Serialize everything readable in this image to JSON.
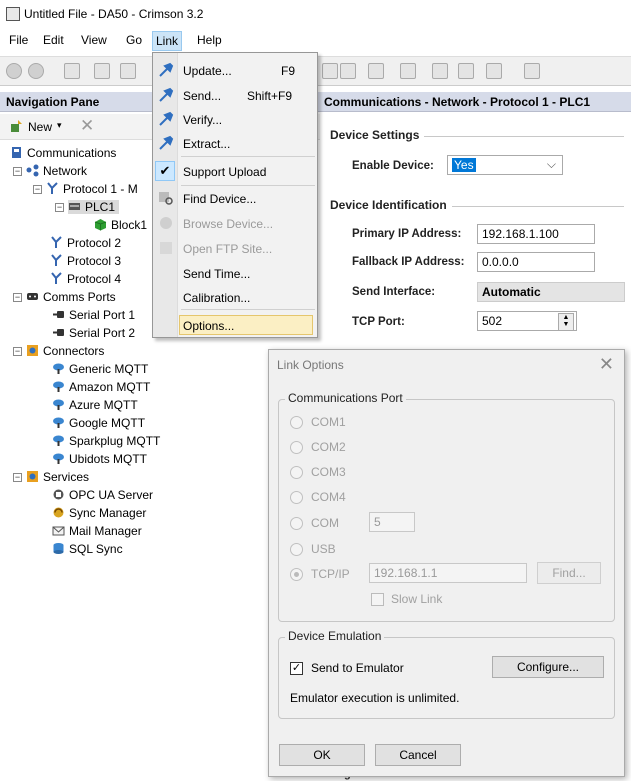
{
  "window": {
    "title": "Untitled File - DA50 - Crimson 3.2"
  },
  "menubar": {
    "items": [
      "File",
      "Edit",
      "View",
      "Go",
      "Link",
      "Help"
    ],
    "active": "Link"
  },
  "nav": {
    "title": "Navigation Pane",
    "new_label": "New",
    "tree": {
      "communications": "Communications",
      "network": "Network",
      "protocol1": "Protocol 1 - M",
      "plc1": "PLC1",
      "block1": "Block1",
      "protocol2": "Protocol 2",
      "protocol3": "Protocol 3",
      "protocol4": "Protocol 4",
      "comms_ports": "Comms Ports",
      "serial1": "Serial Port 1",
      "serial2": "Serial Port 2",
      "connectors": "Connectors",
      "generic": "Generic MQTT",
      "amazon": "Amazon MQTT",
      "azure": "Azure MQTT",
      "google": "Google MQTT",
      "sparkplug": "Sparkplug MQTT",
      "ubidots": "Ubidots MQTT",
      "services": "Services",
      "opcua": "OPC UA Server",
      "sync": "Sync Manager",
      "mail": "Mail Manager",
      "sql": "SQL Sync"
    }
  },
  "panel": {
    "title": "Communications - Network - Protocol 1 - PLC1",
    "device_settings": "Device Settings",
    "enable_label": "Enable Device:",
    "enable_value": "Yes",
    "device_identification": "Device Identification",
    "primary_ip_label": "Primary IP Address:",
    "primary_ip": "192.168.1.100",
    "fallback_ip_label": "Fallback IP Address:",
    "fallback_ip": "0.0.0.0",
    "send_iface_label": "Send Interface:",
    "send_iface": "Automatic",
    "tcp_port_label": "TCP Port:",
    "tcp_port": "502",
    "footer_text": "Register Writes"
  },
  "link_menu": {
    "update": "Update...",
    "update_sc": "F9",
    "send": "Send...",
    "send_sc": "Shift+F9",
    "verify": "Verify...",
    "extract": "Extract...",
    "support_upload": "Support Upload",
    "find_device": "Find Device...",
    "browse_device": "Browse Device...",
    "open_ftp": "Open FTP Site...",
    "send_time": "Send Time...",
    "calibration": "Calibration...",
    "options": "Options..."
  },
  "dialog": {
    "title": "Link Options",
    "close": "✕",
    "comm_port_group": "Communications Port",
    "com1": "COM1",
    "com2": "COM2",
    "com3": "COM3",
    "com4": "COM4",
    "com": "COM",
    "com_value": "5",
    "usb": "USB",
    "tcpip": "TCP/IP",
    "tcpip_value": "192.168.1.1",
    "find": "Find...",
    "slow_link": "Slow Link",
    "emulation_group": "Device Emulation",
    "send_to_emulator": "Send to Emulator",
    "configure": "Configure...",
    "emulator_status": "Emulator execution is unlimited.",
    "ok": "OK",
    "cancel": "Cancel"
  }
}
